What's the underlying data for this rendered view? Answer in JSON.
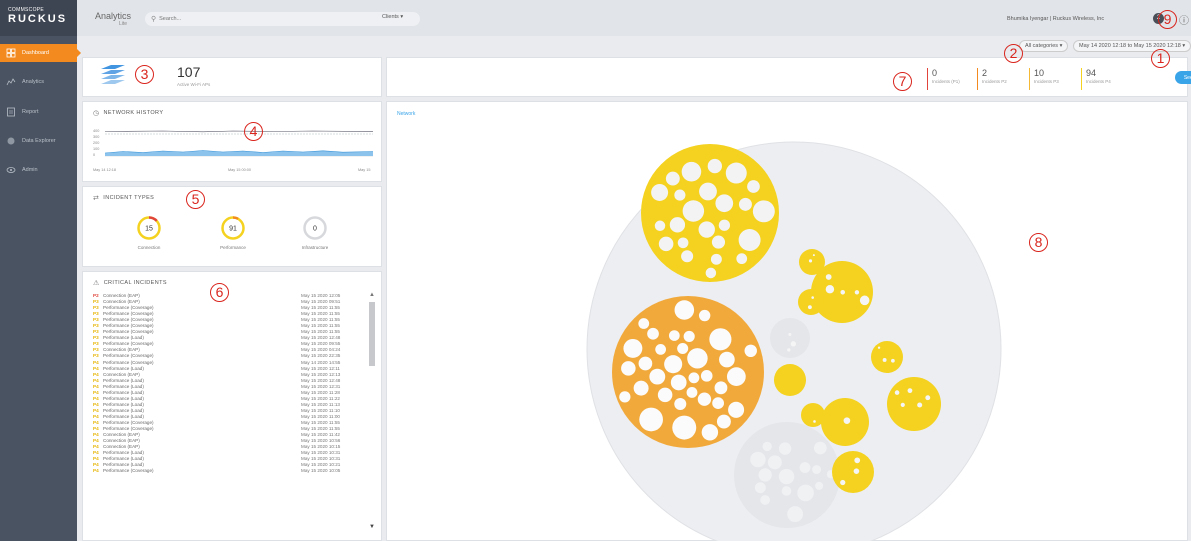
{
  "brand": {
    "company": "COMMSCOPE",
    "product": "RUCKUS"
  },
  "header": {
    "title": "Analytics",
    "subtitle": "Lite",
    "search_placeholder": "Search...",
    "clients_label": "Clients",
    "user": "Bhumika Iyengar | Ruckus Wireless, Inc",
    "notification_count": "2"
  },
  "sidebar": {
    "items": [
      {
        "label": "Dashboard",
        "icon": "dashboard-icon",
        "active": true
      },
      {
        "label": "Analytics",
        "icon": "analytics-icon",
        "active": false
      },
      {
        "label": "Report",
        "icon": "report-icon",
        "active": false
      },
      {
        "label": "Data Explorer",
        "icon": "data-explorer-icon",
        "active": false
      },
      {
        "label": "Admin",
        "icon": "admin-icon",
        "active": false
      }
    ]
  },
  "filters": {
    "categories_label": "All categories",
    "date_range": "May 14 2020 12:18 to May 15 2020 12:18"
  },
  "ap_summary": {
    "count": "107",
    "label": "Active Wi-Fi APs"
  },
  "incident_summary": [
    {
      "count": "0",
      "label": "Incidents (P1)",
      "color": "#e0443a"
    },
    {
      "count": "2",
      "label": "Incidents P2",
      "color": "#f28a1f"
    },
    {
      "count": "10",
      "label": "Incidents P3",
      "color": "#f5b935"
    },
    {
      "count": "94",
      "label": "Incidents P4",
      "color": "#f4d21f"
    }
  ],
  "see_incidents_label": "See Incidents",
  "network_history": {
    "title": "NETWORK HISTORY",
    "y_ticks": [
      "400",
      "300",
      "200",
      "100",
      "0"
    ],
    "x_ticks": [
      "May 14 12:18",
      "May 15 00:00",
      "May 15"
    ]
  },
  "incident_types": {
    "title": "INCIDENT TYPES",
    "items": [
      {
        "count": "15",
        "label": "Connection",
        "fraction": 0.13,
        "color": "#f4d21f",
        "accent": "#e0443a"
      },
      {
        "count": "91",
        "label": "Performance",
        "fraction": 0.08,
        "color": "#f4d21f",
        "accent": "#f28a1f"
      },
      {
        "count": "0",
        "label": "Infrastructure",
        "fraction": 0,
        "color": "#d6d8dc",
        "accent": "#d6d8dc"
      }
    ]
  },
  "critical_incidents": {
    "title": "CRITICAL INCIDENTS",
    "rows": [
      {
        "sev": "P2",
        "cat": "Connection (EAP)",
        "ts": "May 15 2020 12:05"
      },
      {
        "sev": "P3",
        "cat": "Connection (EAP)",
        "ts": "May 15 2020 09:51"
      },
      {
        "sev": "P3",
        "cat": "Performance (Coverage)",
        "ts": "May 15 2020 11:55"
      },
      {
        "sev": "P3",
        "cat": "Performance (Coverage)",
        "ts": "May 15 2020 11:55"
      },
      {
        "sev": "P3",
        "cat": "Performance (Coverage)",
        "ts": "May 15 2020 11:55"
      },
      {
        "sev": "P3",
        "cat": "Performance (Coverage)",
        "ts": "May 15 2020 11:55"
      },
      {
        "sev": "P3",
        "cat": "Performance (Coverage)",
        "ts": "May 15 2020 11:55"
      },
      {
        "sev": "P3",
        "cat": "Performance (Load)",
        "ts": "May 15 2020 12:48"
      },
      {
        "sev": "P3",
        "cat": "Performance (Coverage)",
        "ts": "May 15 2020 09:55"
      },
      {
        "sev": "P3",
        "cat": "Connection (EAP)",
        "ts": "May 15 2020 04:24"
      },
      {
        "sev": "P3",
        "cat": "Performance (Coverage)",
        "ts": "May 15 2020 22:35"
      },
      {
        "sev": "P4",
        "cat": "Performance (Coverage)",
        "ts": "May 14 2020 14:55"
      },
      {
        "sev": "P4",
        "cat": "Performance (Load)",
        "ts": "May 15 2020 12:11"
      },
      {
        "sev": "P4",
        "cat": "Connection (EAP)",
        "ts": "May 15 2020 12:13"
      },
      {
        "sev": "P4",
        "cat": "Performance (Load)",
        "ts": "May 15 2020 12:48"
      },
      {
        "sev": "P4",
        "cat": "Performance (Load)",
        "ts": "May 15 2020 12:31"
      },
      {
        "sev": "P4",
        "cat": "Performance (Load)",
        "ts": "May 15 2020 11:28"
      },
      {
        "sev": "P4",
        "cat": "Performance (Load)",
        "ts": "May 15 2020 11:22"
      },
      {
        "sev": "P4",
        "cat": "Performance (Load)",
        "ts": "May 15 2020 11:13"
      },
      {
        "sev": "P4",
        "cat": "Performance (Load)",
        "ts": "May 15 2020 11:10"
      },
      {
        "sev": "P4",
        "cat": "Performance (Load)",
        "ts": "May 15 2020 11:00"
      },
      {
        "sev": "P4",
        "cat": "Performance (Coverage)",
        "ts": "May 15 2020 11:55"
      },
      {
        "sev": "P4",
        "cat": "Performance (Coverage)",
        "ts": "May 15 2020 11:55"
      },
      {
        "sev": "P4",
        "cat": "Connection (EAP)",
        "ts": "May 15 2020 11:42"
      },
      {
        "sev": "P4",
        "cat": "Connection (EAP)",
        "ts": "May 15 2020 10:56"
      },
      {
        "sev": "P4",
        "cat": "Connection (EAP)",
        "ts": "May 15 2020 10:15"
      },
      {
        "sev": "P4",
        "cat": "Performance (Load)",
        "ts": "May 15 2020 10:31"
      },
      {
        "sev": "P4",
        "cat": "Performance (Load)",
        "ts": "May 15 2020 10:31"
      },
      {
        "sev": "P4",
        "cat": "Performance (Load)",
        "ts": "May 15 2020 10:21"
      },
      {
        "sev": "P4",
        "cat": "Performance (Coverage)",
        "ts": "May 15 2020 10:05"
      }
    ]
  },
  "network_link": "Network",
  "annotations": [
    "1",
    "2",
    "3",
    "4",
    "5",
    "6",
    "7",
    "8",
    "9"
  ],
  "colors": {
    "accent_orange": "#f28a1f",
    "yellow": "#f4d21f",
    "orange_circle": "#f2a93b",
    "grey_circle": "#e2e4e8",
    "blue": "#3aa4e8",
    "annotation_red": "#d9251d"
  }
}
